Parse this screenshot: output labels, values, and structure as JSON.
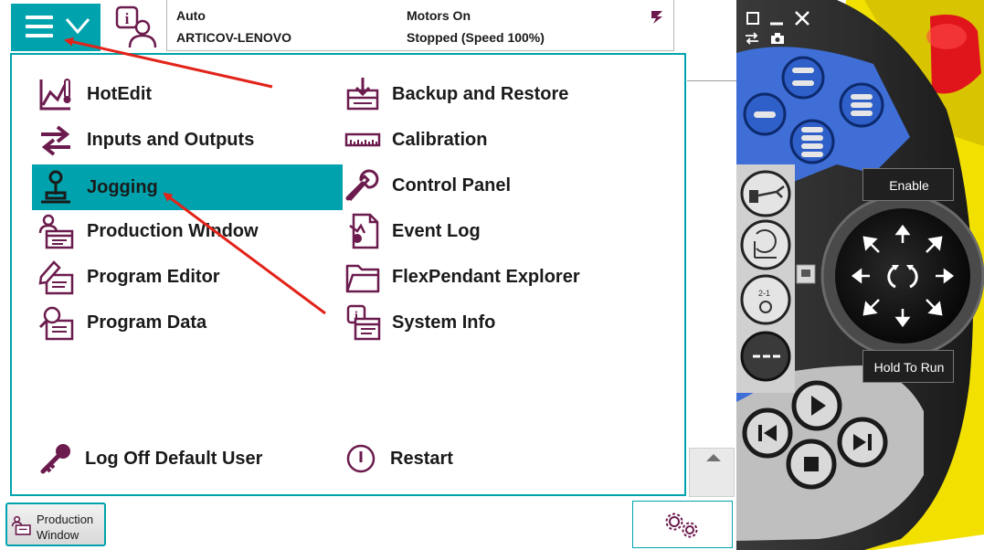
{
  "status": {
    "mode": "Auto",
    "system_name": "ARTICOV-LENOVO",
    "motors": "Motors On",
    "state": "Stopped (Speed 100%)"
  },
  "menu": {
    "left_items": [
      {
        "label": "HotEdit",
        "icon": "hotedit-icon"
      },
      {
        "label": "Inputs and Outputs",
        "icon": "io-arrows-icon"
      },
      {
        "label": "Jogging",
        "icon": "joystick-icon",
        "selected": true
      },
      {
        "label": "Production Window",
        "icon": "production-window-icon"
      },
      {
        "label": "Program Editor",
        "icon": "program-editor-icon"
      },
      {
        "label": "Program Data",
        "icon": "program-data-icon"
      }
    ],
    "right_items": [
      {
        "label": "Backup and Restore",
        "icon": "backup-icon"
      },
      {
        "label": "Calibration",
        "icon": "ruler-icon"
      },
      {
        "label": "Control Panel",
        "icon": "wrench-icon"
      },
      {
        "label": "Event Log",
        "icon": "event-log-icon"
      },
      {
        "label": "FlexPendant Explorer",
        "icon": "folder-icon"
      },
      {
        "label": "System Info",
        "icon": "system-info-icon"
      }
    ],
    "log_off": "Log Off Default User",
    "restart": "Restart"
  },
  "taskbar": {
    "production_window_line1": "Production",
    "production_window_line2": "Window"
  },
  "pendant": {
    "enable_label": "Enable",
    "hold_to_run_label": "Hold To Run"
  },
  "colors": {
    "accent_teal": "#00a3ad",
    "icon_maroon": "#6b1b4d",
    "pendant_blue": "#3f6fd6",
    "pendant_dark": "#2a2a2a",
    "emergency_red": "#e0151b",
    "pendant_yellow": "#f2e100",
    "arrow_red": "#e2231a"
  }
}
